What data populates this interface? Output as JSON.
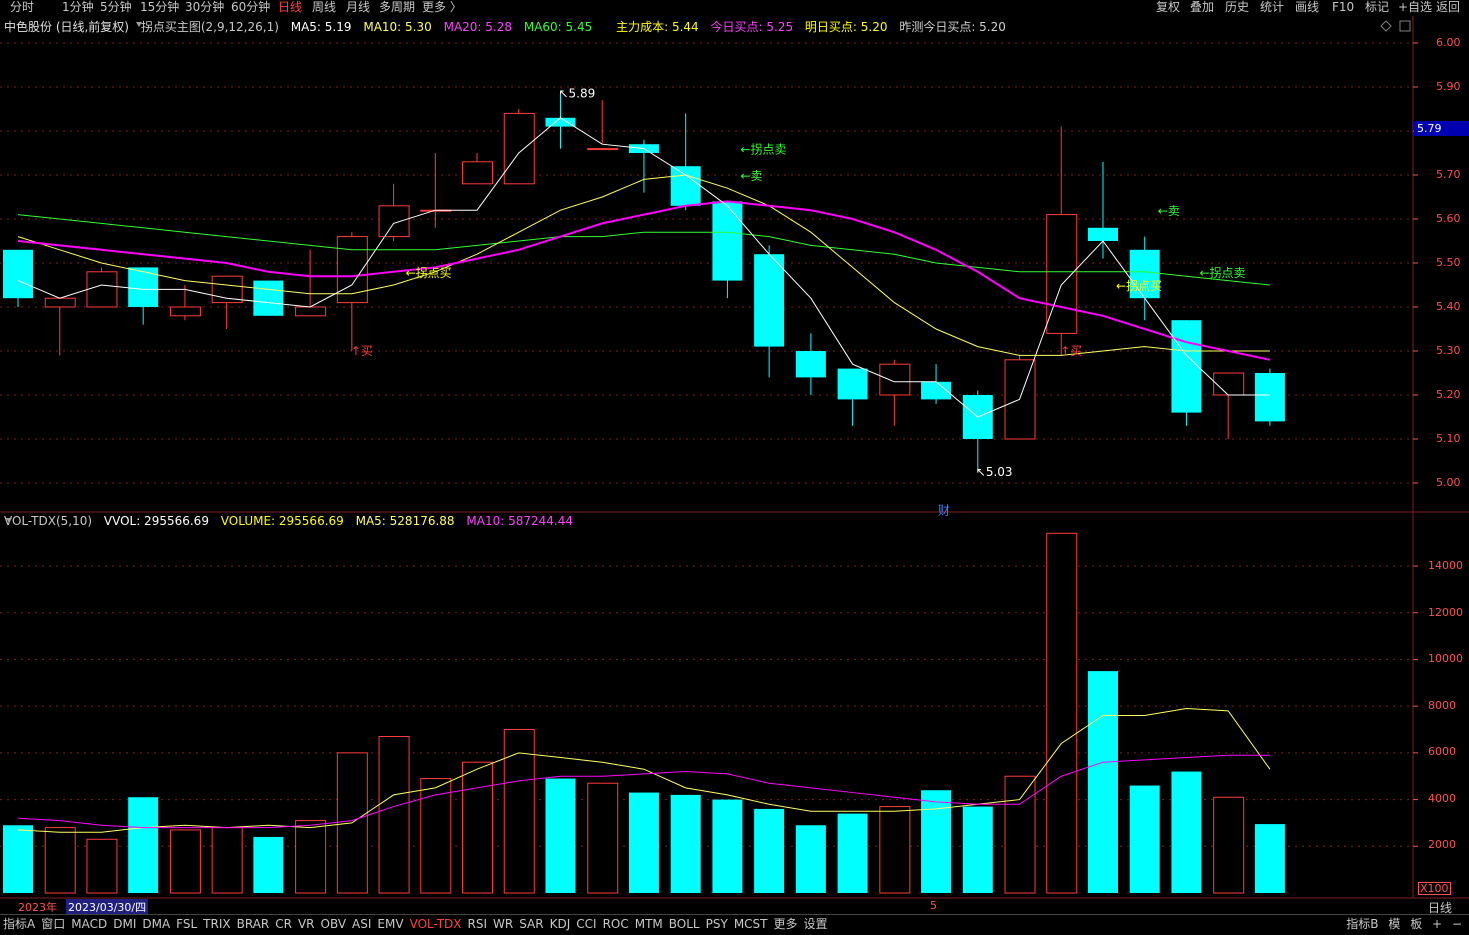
{
  "periods": [
    "分时",
    "1分钟",
    "5分钟",
    "15分钟",
    "30分钟",
    "60分钟",
    "日线",
    "周线",
    "月线",
    "多周期",
    "更多 〉"
  ],
  "active_period": "日线",
  "toolbar_right": [
    "复权",
    "叠加",
    "历史",
    "统计",
    "画线",
    "F10",
    "标记",
    "+自选",
    "返回"
  ],
  "main_info": {
    "stock": "中色股份 (日线,前复权)",
    "indicator": "拐点买主图(2,9,12,26,1)",
    "ma5": "MA5: 5.19",
    "ma10": "MA10: 5.30",
    "ma20": "MA20: 5.28",
    "ma60": "MA60: 5.45",
    "cost": "主力成本: 5.44",
    "today_buy": "今日买点: 5.25",
    "tomorrow_buy": "明日买点: 5.20",
    "yesterday_buy": "昨测今日买点: 5.20"
  },
  "vol_info": {
    "name": "VOL-TDX(5,10)",
    "vvol": "VVOL: 295566.69",
    "volume": "VOLUME: 295566.69",
    "ma5": "MA5: 528176.88",
    "ma10": "MA10: 587244.44"
  },
  "price_axis": [
    "6.00",
    "5.90",
    "5.80",
    "5.70",
    "5.60",
    "5.50",
    "5.40",
    "5.30",
    "5.20",
    "5.10",
    "5.00"
  ],
  "current_price": "5.79",
  "vol_axis": [
    "14000",
    "12000",
    "10000",
    "8000",
    "6000",
    "4000",
    "2000"
  ],
  "vol_unit": "X100",
  "annotations": {
    "high": "5.89",
    "low": "5.03",
    "buy1": "买",
    "buy2": "买",
    "turn_buy1": "←拐点买",
    "turn_buy2": "←拐点买",
    "turn_sell1": "←拐点卖",
    "turn_sell2": "←拐点卖",
    "sell1": "←卖",
    "sell2": "←卖",
    "cai": "财"
  },
  "date_bar": {
    "year": "2023年",
    "cursor_date": "2023/03/30/四",
    "month_mark": "5",
    "period": "日线"
  },
  "bottom_tabs": [
    "指标A",
    "窗口",
    "MACD",
    "DMI",
    "DMA",
    "FSL",
    "TRIX",
    "BRAR",
    "CR",
    "VR",
    "OBV",
    "ASI",
    "EMV",
    "VOL-TDX",
    "RSI",
    "WR",
    "SAR",
    "KDJ",
    "CCI",
    "ROC",
    "MTM",
    "BOLL",
    "PSY",
    "MCST",
    "更多",
    "设置"
  ],
  "active_tab": "VOL-TDX",
  "bottom_right": [
    "指标B",
    "模",
    "板",
    "+",
    "−"
  ],
  "colors": {
    "up": "#ff3b3b",
    "down": "#00ffff",
    "ma5": "#ffffff",
    "ma10": "#ffff60",
    "ma20": "#ff00ff",
    "ma60": "#30ff30",
    "grid": "#802020"
  },
  "chart_data": {
    "type": "candlestick",
    "price_range": [
      5.0,
      6.0
    ],
    "candles": [
      {
        "o": 5.53,
        "c": 5.42,
        "h": 5.53,
        "l": 5.4
      },
      {
        "o": 5.4,
        "c": 5.42,
        "h": 5.42,
        "l": 5.29
      },
      {
        "o": 5.4,
        "c": 5.48,
        "h": 5.49,
        "l": 5.4
      },
      {
        "o": 5.49,
        "c": 5.4,
        "h": 5.49,
        "l": 5.36
      },
      {
        "o": 5.38,
        "c": 5.4,
        "h": 5.45,
        "l": 5.37
      },
      {
        "o": 5.41,
        "c": 5.47,
        "h": 5.47,
        "l": 5.35
      },
      {
        "o": 5.46,
        "c": 5.38,
        "h": 5.46,
        "l": 5.38
      },
      {
        "o": 5.38,
        "c": 5.4,
        "h": 5.53,
        "l": 5.38
      },
      {
        "o": 5.41,
        "c": 5.56,
        "h": 5.57,
        "l": 5.3
      },
      {
        "o": 5.56,
        "c": 5.63,
        "h": 5.68,
        "l": 5.55
      },
      {
        "o": 5.62,
        "c": 5.62,
        "h": 5.75,
        "l": 5.58
      },
      {
        "o": 5.68,
        "c": 5.73,
        "h": 5.75,
        "l": 5.68
      },
      {
        "o": 5.68,
        "c": 5.84,
        "h": 5.85,
        "l": 5.68
      },
      {
        "o": 5.83,
        "c": 5.81,
        "h": 5.89,
        "l": 5.76
      },
      {
        "o": 5.76,
        "c": 5.76,
        "h": 5.87,
        "l": 5.77
      },
      {
        "o": 5.77,
        "c": 5.75,
        "h": 5.78,
        "l": 5.66
      },
      {
        "o": 5.72,
        "c": 5.63,
        "h": 5.84,
        "l": 5.62
      },
      {
        "o": 5.64,
        "c": 5.46,
        "h": 5.64,
        "l": 5.42
      },
      {
        "o": 5.52,
        "c": 5.31,
        "h": 5.54,
        "l": 5.24
      },
      {
        "o": 5.3,
        "c": 5.24,
        "h": 5.34,
        "l": 5.2
      },
      {
        "o": 5.26,
        "c": 5.19,
        "h": 5.26,
        "l": 5.13
      },
      {
        "o": 5.2,
        "c": 5.27,
        "h": 5.28,
        "l": 5.13
      },
      {
        "o": 5.23,
        "c": 5.19,
        "h": 5.27,
        "l": 5.18
      },
      {
        "o": 5.2,
        "c": 5.1,
        "h": 5.21,
        "l": 5.03
      },
      {
        "o": 5.1,
        "c": 5.28,
        "h": 5.29,
        "l": 5.1
      },
      {
        "o": 5.34,
        "c": 5.61,
        "h": 5.81,
        "l": 5.29
      },
      {
        "o": 5.58,
        "c": 5.55,
        "h": 5.73,
        "l": 5.51
      },
      {
        "o": 5.53,
        "c": 5.42,
        "h": 5.56,
        "l": 5.37
      },
      {
        "o": 5.37,
        "c": 5.16,
        "h": 5.37,
        "l": 5.13
      },
      {
        "o": 5.2,
        "c": 5.25,
        "h": 5.25,
        "l": 5.1
      },
      {
        "o": 5.25,
        "c": 5.14,
        "h": 5.26,
        "l": 5.13
      }
    ],
    "ma5": [
      5.46,
      5.42,
      5.45,
      5.44,
      5.44,
      5.42,
      5.41,
      5.4,
      5.45,
      5.59,
      5.62,
      5.62,
      5.75,
      5.83,
      5.77,
      5.76,
      5.7,
      5.63,
      5.52,
      5.42,
      5.27,
      5.23,
      5.23,
      5.15,
      5.19,
      5.45,
      5.55,
      5.42,
      5.29,
      5.2,
      5.2
    ],
    "ma10": [
      5.56,
      5.53,
      5.5,
      5.48,
      5.46,
      5.45,
      5.44,
      5.43,
      5.43,
      5.45,
      5.48,
      5.52,
      5.57,
      5.62,
      5.65,
      5.69,
      5.7,
      5.67,
      5.63,
      5.57,
      5.49,
      5.41,
      5.35,
      5.31,
      5.29,
      5.29,
      5.3,
      5.31,
      5.3,
      5.3,
      5.3
    ],
    "ma20": [
      5.55,
      5.54,
      5.53,
      5.52,
      5.51,
      5.5,
      5.48,
      5.47,
      5.47,
      5.48,
      5.49,
      5.51,
      5.53,
      5.56,
      5.59,
      5.61,
      5.63,
      5.64,
      5.63,
      5.62,
      5.6,
      5.57,
      5.53,
      5.48,
      5.42,
      5.4,
      5.38,
      5.35,
      5.32,
      5.3,
      5.28
    ],
    "ma60": [
      5.61,
      5.6,
      5.59,
      5.58,
      5.57,
      5.56,
      5.55,
      5.54,
      5.53,
      5.53,
      5.53,
      5.54,
      5.55,
      5.56,
      5.56,
      5.57,
      5.57,
      5.57,
      5.56,
      5.54,
      5.53,
      5.52,
      5.5,
      5.49,
      5.48,
      5.48,
      5.48,
      5.48,
      5.47,
      5.46,
      5.45
    ],
    "volume_range": [
      0,
      15000
    ],
    "volume": [
      2900,
      2800,
      2300,
      4100,
      2700,
      2800,
      2400,
      3100,
      6000,
      6700,
      4900,
      5600,
      7000,
      4900,
      4700,
      4300,
      4200,
      4000,
      3600,
      2900,
      3400,
      3700,
      4400,
      3700,
      5000,
      15400,
      9500,
      4600,
      5200,
      4100,
      2950
    ],
    "vol_ma5": [
      2700,
      2600,
      2600,
      2800,
      2900,
      2800,
      2900,
      2800,
      3000,
      4200,
      4500,
      5300,
      6000,
      5800,
      5600,
      5300,
      4500,
      4200,
      3800,
      3500,
      3500,
      3500,
      3600,
      3800,
      4000,
      6400,
      7600,
      7600,
      7900,
      7800,
      5300
    ],
    "vol_ma10": [
      3200,
      3100,
      2900,
      2800,
      2800,
      2800,
      2800,
      2900,
      3100,
      3700,
      4200,
      4500,
      4800,
      5000,
      5000,
      5100,
      5200,
      5100,
      4700,
      4500,
      4300,
      4100,
      3900,
      3800,
      3800,
      5000,
      5600,
      5700,
      5800,
      5900,
      5900
    ]
  }
}
